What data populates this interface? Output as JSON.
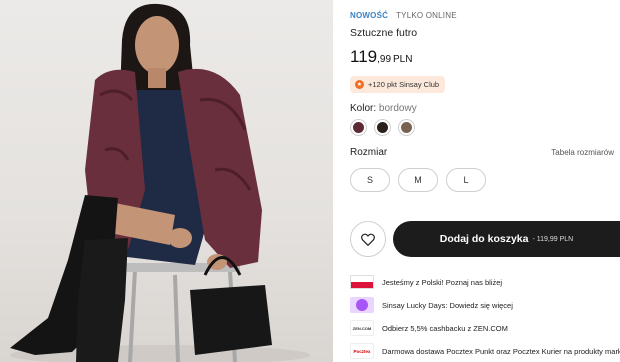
{
  "product": {
    "badge_new": "NOWOŚĆ",
    "badge_online": "TYLKO ONLINE",
    "title": "Sztuczne futro",
    "price_main": "119",
    "price_decimal": ",99",
    "price_currency": "PLN",
    "club_points": "+120 pkt Sinsay Club"
  },
  "color": {
    "label": "Kolor:",
    "value": "bordowy",
    "swatches": [
      {
        "name": "burgundy",
        "hex": "#5b2a35"
      },
      {
        "name": "black",
        "hex": "#2a211d"
      },
      {
        "name": "brown",
        "hex": "#7a6250"
      }
    ]
  },
  "size": {
    "label": "Rozmiar",
    "table_link": "Tabela rozmiarów",
    "options": [
      "S",
      "M",
      "L"
    ]
  },
  "actions": {
    "favorite_icon": "heart-icon",
    "add_to_cart": "Dodaj do koszyka",
    "add_to_cart_price": "- 119,99 PLN"
  },
  "info": [
    {
      "icon": "poland-flag-icon",
      "text": "Jesteśmy z Polski! Poznaj nas bliżej"
    },
    {
      "icon": "lucky-days-icon",
      "text": "Sinsay Lucky Days: Dowiedz się więcej"
    },
    {
      "icon": "zen-icon",
      "icon_text": "ZEN.COM",
      "text": "Odbierz 5,5% cashbacku z ZEN.COM"
    },
    {
      "icon": "pocztex-icon",
      "icon_text": "Pocztex",
      "text": "Darmowa dostawa Pocztex Punkt oraz Pocztex Kurier na produkty marki Sinsay"
    }
  ],
  "colors": {
    "accent_blue": "#3b82c4",
    "cart_button": "#1c1c1c",
    "club_bg": "#fde9dc",
    "club_icon": "#f26b21"
  }
}
